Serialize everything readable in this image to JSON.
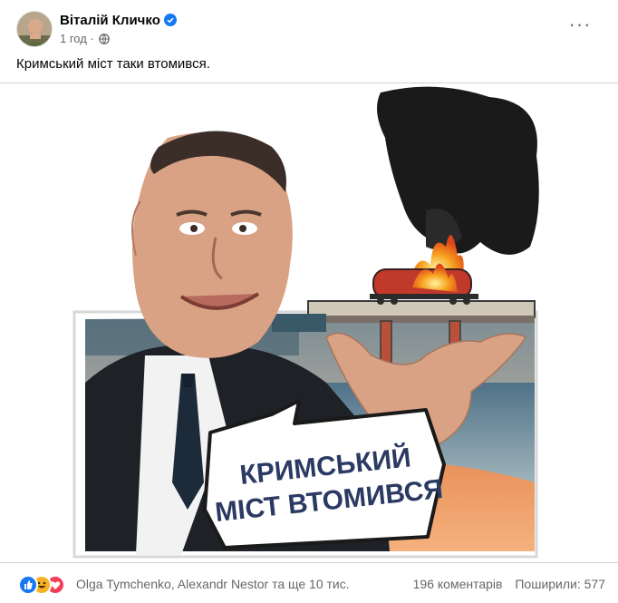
{
  "post": {
    "author": "Віталій Кличко",
    "time": "1 год",
    "privacy_icon": "globe-icon",
    "verified_icon": "verified-badge-icon",
    "text": "Кримський міст таки втомився."
  },
  "image": {
    "caption_line1": "КРИМСЬКИЙ",
    "caption_line2": "МІСТ ВТОМИВСЯ"
  },
  "footer": {
    "reactions": [
      "like-icon",
      "haha-icon",
      "love-icon"
    ],
    "reaction_names": "Olga Tymchenko, Alexandr Nestor та ще 10 тис.",
    "comments": "196 коментарів",
    "shares": "Поширили: 577"
  },
  "colors": {
    "facebook_blue": "#1877f2",
    "secondary_text": "#65676b",
    "smoke": "#1a1a1a",
    "fire": "#f28c1b",
    "tank": "#c0392b"
  }
}
